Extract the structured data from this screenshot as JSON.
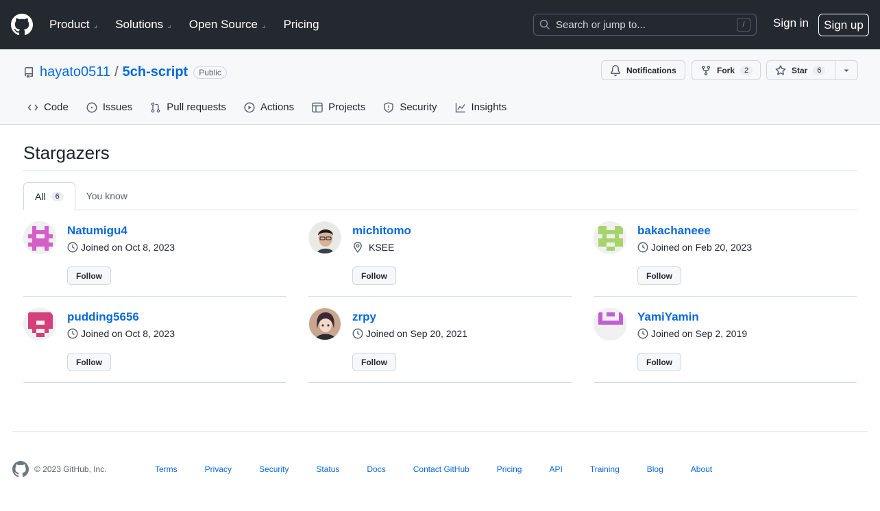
{
  "header": {
    "nav": [
      {
        "label": "Product",
        "dropdown": true
      },
      {
        "label": "Solutions",
        "dropdown": true
      },
      {
        "label": "Open Source",
        "dropdown": true
      },
      {
        "label": "Pricing",
        "dropdown": false
      }
    ],
    "search_placeholder": "Search or jump to...",
    "search_shortcut": "/",
    "sign_in": "Sign in",
    "sign_up": "Sign up"
  },
  "repo": {
    "owner": "hayato0511",
    "separator": "/",
    "name": "5ch-script",
    "visibility": "Public",
    "notifications_label": "Notifications",
    "fork_label": "Fork",
    "fork_count": "2",
    "star_label": "Star",
    "star_count": "6"
  },
  "tabs": [
    "Code",
    "Issues",
    "Pull requests",
    "Actions",
    "Projects",
    "Security",
    "Insights"
  ],
  "page": {
    "title": "Stargazers",
    "subtabs": {
      "all_label": "All",
      "all_count": "6",
      "you_know_label": "You know"
    }
  },
  "stargazers": [
    {
      "username": "Natumigu4",
      "detail": "Joined on Oct 8, 2023",
      "detail_type": "joined",
      "follow": "Follow"
    },
    {
      "username": "michitomo",
      "detail": "KSEE",
      "detail_type": "location",
      "follow": "Follow"
    },
    {
      "username": "bakachaneee",
      "detail": "Joined on Feb 20, 2023",
      "detail_type": "joined",
      "follow": "Follow"
    },
    {
      "username": "pudding5656",
      "detail": "Joined on Oct 8, 2023",
      "detail_type": "joined",
      "follow": "Follow"
    },
    {
      "username": "zrpy",
      "detail": "Joined on Sep 20, 2021",
      "detail_type": "joined",
      "follow": "Follow"
    },
    {
      "username": "YamiYamin",
      "detail": "Joined on Sep 2, 2019",
      "detail_type": "joined",
      "follow": "Follow"
    }
  ],
  "footer": {
    "copyright": "© 2023 GitHub, Inc.",
    "links": [
      "Terms",
      "Privacy",
      "Security",
      "Status",
      "Docs",
      "Contact GitHub",
      "Pricing",
      "API",
      "Training",
      "Blog",
      "About"
    ]
  },
  "colors": {
    "header_bg": "#24292f",
    "link": "#0969da",
    "border": "#d0d7de"
  }
}
